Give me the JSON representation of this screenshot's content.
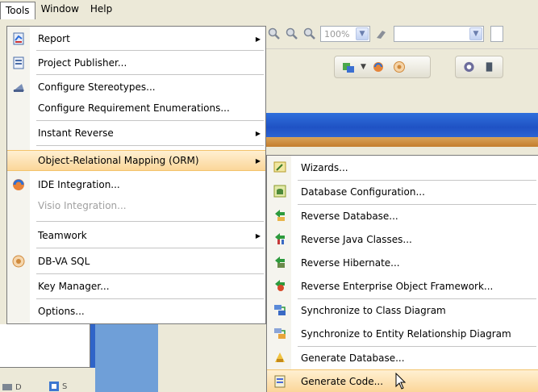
{
  "menubar": {
    "items": [
      "Tools",
      "Window",
      "Help"
    ]
  },
  "toolbar": {
    "zoom_value": "100%"
  },
  "tools_menu": {
    "items": [
      {
        "label": "Report",
        "icon": "report-icon",
        "submenu": true
      },
      {
        "label": "Project Publisher...",
        "icon": "publisher-icon"
      },
      {
        "label": "Configure Stereotypes...",
        "icon": "stereotypes-icon"
      },
      {
        "label": "Configure Requirement Enumerations..."
      },
      {
        "label": "Instant Reverse",
        "submenu": true
      },
      {
        "label": "Object-Relational Mapping (ORM)",
        "submenu": true,
        "highlighted": true
      },
      {
        "label": "IDE Integration...",
        "icon": "ide-icon"
      },
      {
        "label": "Visio Integration...",
        "disabled": true
      },
      {
        "label": "Teamwork",
        "submenu": true
      },
      {
        "label": "DB-VA SQL",
        "icon": "dbva-icon"
      },
      {
        "label": "Key Manager..."
      },
      {
        "label": "Options..."
      }
    ]
  },
  "orm_submenu": {
    "items": [
      {
        "label": "Wizards...",
        "icon": "wizard-icon"
      },
      {
        "label": "Database Configuration...",
        "icon": "db-config-icon"
      },
      {
        "label": "Reverse Database...",
        "icon": "reverse-db-icon"
      },
      {
        "label": "Reverse Java Classes...",
        "icon": "reverse-java-icon"
      },
      {
        "label": "Reverse Hibernate...",
        "icon": "reverse-hibernate-icon"
      },
      {
        "label": "Reverse Enterprise Object Framework...",
        "icon": "reverse-eof-icon"
      },
      {
        "label": "Synchronize to Class Diagram",
        "icon": "sync-class-icon"
      },
      {
        "label": "Synchronize to Entity Relationship Diagram",
        "icon": "sync-erd-icon"
      },
      {
        "label": "Generate Database...",
        "icon": "generate-db-icon"
      },
      {
        "label": "Generate Code...",
        "icon": "generate-code-icon",
        "highlighted": true
      }
    ]
  },
  "statusbar": {
    "tab1": "D",
    "tab2": "S"
  },
  "colors": {
    "highlight_top": "#fff0d2",
    "highlight_bottom": "#fbd699",
    "title_blue": "#1f52c4",
    "menu_border": "#7a7a7a"
  }
}
